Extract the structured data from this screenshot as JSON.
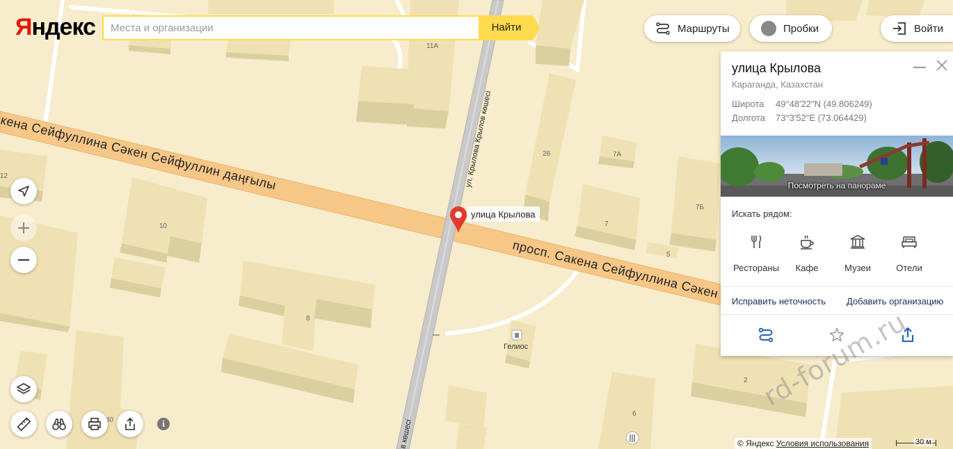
{
  "header": {
    "logo_first": "Я",
    "logo_rest": "ндекс",
    "search_placeholder": "Места и организации",
    "search_button": "Найти",
    "routes_label": "Маршруты",
    "traffic_label": "Пробки",
    "login_label": "Войти"
  },
  "map": {
    "streets": {
      "main_north": "проспект Сакена Сейфуллина Сәкен Сейфуллин даңғылы",
      "main_north_visible": "кена Сейфуллина Сәкен Сейфуллин даңғылы",
      "main_south": "просп. Сакена Сейфуллина Сәкен",
      "side_top": "ул. Крылова Крылов көшесі",
      "side_bottom": "в көшесі"
    },
    "marker_label": "улица Крылова",
    "poi_gas": "Гелиос",
    "house_numbers": {
      "h11a": "11А",
      "h26": "26",
      "h7a": "7А",
      "h12": "12",
      "h10": "10",
      "h7": "7",
      "h7b": "7Б",
      "h5": "5",
      "h8": "8",
      "h2": "2",
      "h6": "6",
      "h40": "40"
    }
  },
  "card": {
    "title": "улица Крылова",
    "subtitle": "Караганда, Казахстан",
    "lat_label": "Широта",
    "lat_value": "49°48′22″N (49.806249)",
    "lon_label": "Долгота",
    "lon_value": "73°3′52″E (73.064429)",
    "panorama_label": "Посмотреть на панораме",
    "nearby_title": "Искать рядом:",
    "categories": [
      {
        "label": "Рестораны",
        "icon": "fork-knife-icon"
      },
      {
        "label": "Кафе",
        "icon": "coffee-cup-icon"
      },
      {
        "label": "Музеи",
        "icon": "museum-icon"
      },
      {
        "label": "Отели",
        "icon": "bed-icon"
      }
    ],
    "fix_link": "Исправить неточность",
    "add_link": "Добавить организацию"
  },
  "footer": {
    "copyright": "© Яндекс",
    "terms": "Условия использования",
    "scale": "30 м"
  },
  "watermark": "rd-forum.ru",
  "colors": {
    "map_bg": "#f7eccb",
    "building": "#efe1b4",
    "main_road": "#f7c788",
    "side_road": "#c8c8c8",
    "accent_yellow": "#ffdb4d",
    "marker_red": "#e23a2e",
    "link_blue": "#1a2b5a"
  }
}
